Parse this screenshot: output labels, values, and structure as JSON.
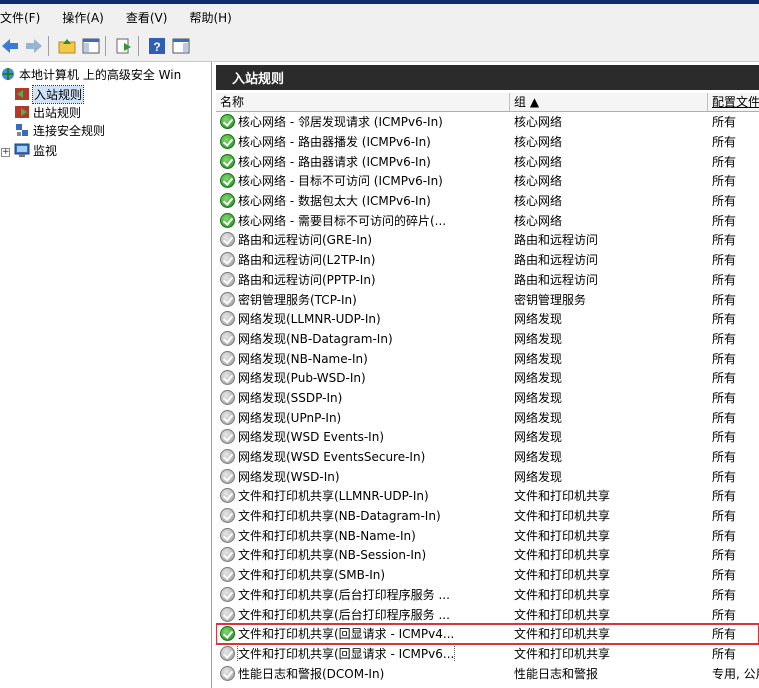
{
  "menu": [
    "文件(F)",
    "操作(A)",
    "查看(V)",
    "帮助(H)"
  ],
  "toolbar_icons": [
    "back-icon",
    "forward-icon",
    "up-folder-icon",
    "show-hide-tree-icon",
    "export-list-icon",
    "help-icon",
    "show-hide-action-pane-icon"
  ],
  "tree": {
    "root": "本地计算机 上的高级安全 Win",
    "items": [
      "入站规则",
      "出站规则",
      "连接安全规则",
      "监视"
    ],
    "expander": "+"
  },
  "pane": {
    "title": "入站规则",
    "columns": [
      "名称",
      "组 ▲",
      "配置文件"
    ]
  },
  "colors": {
    "enabled": "#2e9b2e",
    "disabled": "#9a9a9a",
    "highlight_border": "#d9343a",
    "header_bg": "#2b2b2b"
  },
  "rules": [
    {
      "name": "核心网络 - 邻居发现请求 (ICMPv6-In)",
      "group": "核心网络",
      "profile": "所有",
      "enabled": true
    },
    {
      "name": "核心网络 - 路由器播发 (ICMPv6-In)",
      "group": "核心网络",
      "profile": "所有",
      "enabled": true
    },
    {
      "name": "核心网络 - 路由器请求 (ICMPv6-In)",
      "group": "核心网络",
      "profile": "所有",
      "enabled": true
    },
    {
      "name": "核心网络 - 目标不可访问 (ICMPv6-In)",
      "group": "核心网络",
      "profile": "所有",
      "enabled": true
    },
    {
      "name": "核心网络 - 数据包太大 (ICMPv6-In)",
      "group": "核心网络",
      "profile": "所有",
      "enabled": true
    },
    {
      "name": "核心网络 - 需要目标不可访问的碎片(...",
      "group": "核心网络",
      "profile": "所有",
      "enabled": true
    },
    {
      "name": "路由和远程访问(GRE-In)",
      "group": "路由和远程访问",
      "profile": "所有",
      "enabled": false
    },
    {
      "name": "路由和远程访问(L2TP-In)",
      "group": "路由和远程访问",
      "profile": "所有",
      "enabled": false
    },
    {
      "name": "路由和远程访问(PPTP-In)",
      "group": "路由和远程访问",
      "profile": "所有",
      "enabled": false
    },
    {
      "name": "密钥管理服务(TCP-In)",
      "group": "密钥管理服务",
      "profile": "所有",
      "enabled": false
    },
    {
      "name": "网络发现(LLMNR-UDP-In)",
      "group": "网络发现",
      "profile": "所有",
      "enabled": false
    },
    {
      "name": "网络发现(NB-Datagram-In)",
      "group": "网络发现",
      "profile": "所有",
      "enabled": false
    },
    {
      "name": "网络发现(NB-Name-In)",
      "group": "网络发现",
      "profile": "所有",
      "enabled": false
    },
    {
      "name": "网络发现(Pub-WSD-In)",
      "group": "网络发现",
      "profile": "所有",
      "enabled": false
    },
    {
      "name": "网络发现(SSDP-In)",
      "group": "网络发现",
      "profile": "所有",
      "enabled": false
    },
    {
      "name": "网络发现(UPnP-In)",
      "group": "网络发现",
      "profile": "所有",
      "enabled": false
    },
    {
      "name": "网络发现(WSD Events-In)",
      "group": "网络发现",
      "profile": "所有",
      "enabled": false
    },
    {
      "name": "网络发现(WSD EventsSecure-In)",
      "group": "网络发现",
      "profile": "所有",
      "enabled": false
    },
    {
      "name": "网络发现(WSD-In)",
      "group": "网络发现",
      "profile": "所有",
      "enabled": false
    },
    {
      "name": "文件和打印机共享(LLMNR-UDP-In)",
      "group": "文件和打印机共享",
      "profile": "所有",
      "enabled": false
    },
    {
      "name": "文件和打印机共享(NB-Datagram-In)",
      "group": "文件和打印机共享",
      "profile": "所有",
      "enabled": false
    },
    {
      "name": "文件和打印机共享(NB-Name-In)",
      "group": "文件和打印机共享",
      "profile": "所有",
      "enabled": false
    },
    {
      "name": "文件和打印机共享(NB-Session-In)",
      "group": "文件和打印机共享",
      "profile": "所有",
      "enabled": false
    },
    {
      "name": "文件和打印机共享(SMB-In)",
      "group": "文件和打印机共享",
      "profile": "所有",
      "enabled": false
    },
    {
      "name": "文件和打印机共享(后台打印程序服务 ...",
      "group": "文件和打印机共享",
      "profile": "所有",
      "enabled": false
    },
    {
      "name": "文件和打印机共享(后台打印程序服务 ...",
      "group": "文件和打印机共享",
      "profile": "所有",
      "enabled": false
    },
    {
      "name": "文件和打印机共享(回显请求 - ICMPv4...",
      "group": "文件和打印机共享",
      "profile": "所有",
      "enabled": true,
      "highlighted": true
    },
    {
      "name": "文件和打印机共享(回显请求 - ICMPv6...",
      "group": "文件和打印机共享",
      "profile": "所有",
      "enabled": false,
      "focused": true
    },
    {
      "name": "性能日志和警报(DCOM-In)",
      "group": "性能日志和警报",
      "profile": "专用, 公用",
      "enabled": false
    }
  ]
}
